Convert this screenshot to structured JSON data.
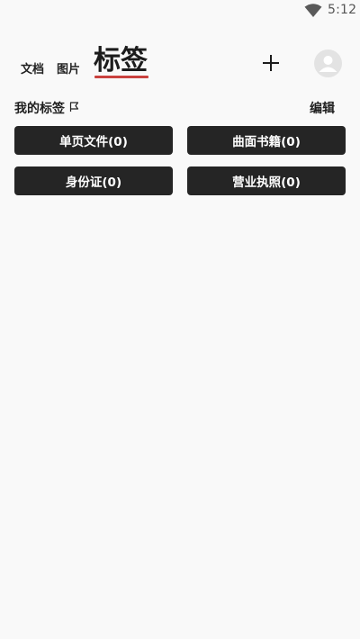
{
  "status_bar": {
    "time": "5:12",
    "wifi_icon": "wifi-icon"
  },
  "header": {
    "tabs": [
      {
        "label": "文档",
        "active": false
      },
      {
        "label": "图片",
        "active": false
      },
      {
        "label": "标签",
        "active": true
      }
    ],
    "accent_color": "#c9413f",
    "add_icon": "plus-icon",
    "avatar_icon": "user-avatar-icon"
  },
  "section": {
    "title": "我的标签",
    "title_icon": "flag-icon",
    "edit_label": "编辑"
  },
  "tags": [
    {
      "label": "单页文件(0)"
    },
    {
      "label": "曲面书籍(0)"
    },
    {
      "label": "身份证(0)"
    },
    {
      "label": "营业执照(0)"
    }
  ]
}
